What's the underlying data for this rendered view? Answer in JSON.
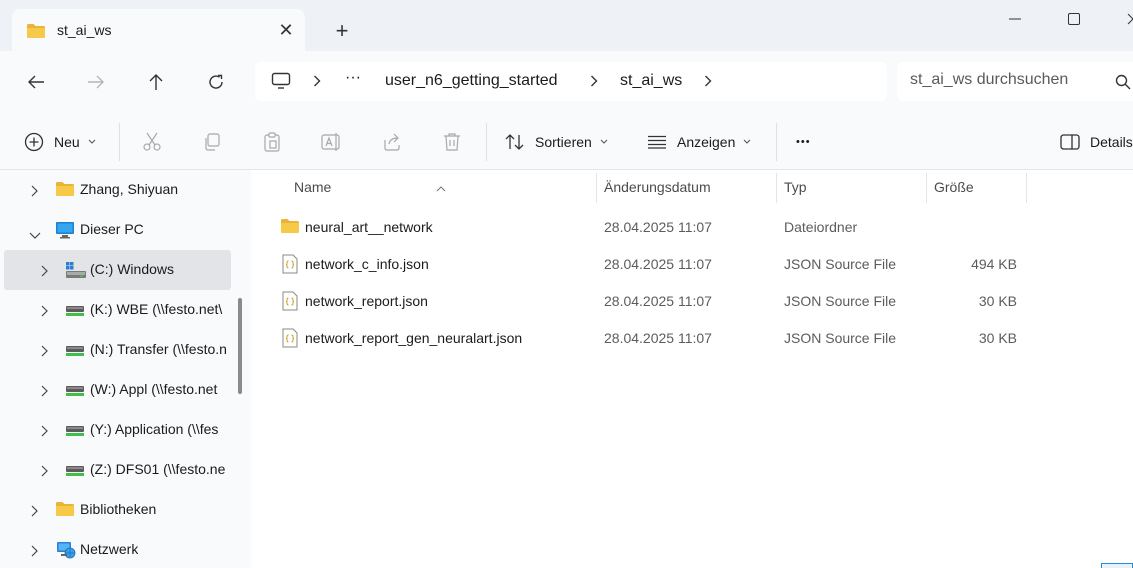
{
  "tab": {
    "title": "st_ai_ws",
    "close": "✕",
    "new_tab": "+"
  },
  "breadcrumb": {
    "more": "···",
    "items": [
      "user_n6_getting_started",
      "st_ai_ws"
    ]
  },
  "search": {
    "placeholder": "st_ai_ws durchsuchen"
  },
  "commands": {
    "new": "Neu",
    "sort": "Sortieren",
    "view": "Anzeigen",
    "more": "•••",
    "details": "Details"
  },
  "sidebar": {
    "items": [
      {
        "label": "Zhang, Shiyuan",
        "icon": "folder-icon",
        "expanded": false
      },
      {
        "label": "Dieser PC",
        "icon": "computer-icon",
        "expanded": true
      },
      {
        "label": "(C:) Windows",
        "icon": "windows-drive-icon",
        "expanded": false,
        "selected": true
      },
      {
        "label": "(K:) WBE (\\\\festo.net\\",
        "icon": "network-drive-icon",
        "expanded": false
      },
      {
        "label": "(N:) Transfer (\\\\festo.n",
        "icon": "network-drive-icon",
        "expanded": false
      },
      {
        "label": "(W:) Appl (\\\\festo.net",
        "icon": "network-drive-icon",
        "expanded": false
      },
      {
        "label": "(Y:) Application (\\\\fes",
        "icon": "network-drive-icon",
        "expanded": false
      },
      {
        "label": "(Z:) DFS01 (\\\\festo.ne",
        "icon": "network-drive-icon",
        "expanded": false
      },
      {
        "label": "Bibliotheken",
        "icon": "library-icon",
        "expanded": false
      },
      {
        "label": "Netzwerk",
        "icon": "network-icon",
        "expanded": false
      }
    ]
  },
  "columns": {
    "name": "Name",
    "date": "Änderungsdatum",
    "type": "Typ",
    "size": "Größe"
  },
  "files": [
    {
      "name": "neural_art__network",
      "date": "28.04.2025 11:07",
      "type": "Dateiordner",
      "size": "",
      "icon": "folder-icon"
    },
    {
      "name": "network_c_info.json",
      "date": "28.04.2025 11:07",
      "type": "JSON Source File",
      "size": "494 KB",
      "icon": "json-file-icon"
    },
    {
      "name": "network_report.json",
      "date": "28.04.2025 11:07",
      "type": "JSON Source File",
      "size": "30 KB",
      "icon": "json-file-icon"
    },
    {
      "name": "network_report_gen_neuralart.json",
      "date": "28.04.2025 11:07",
      "type": "JSON Source File",
      "size": "30 KB",
      "icon": "json-file-icon"
    }
  ],
  "colors": {
    "accent": "#0067c0",
    "folder": "#f7c948",
    "selected": "#e3e4e8"
  }
}
